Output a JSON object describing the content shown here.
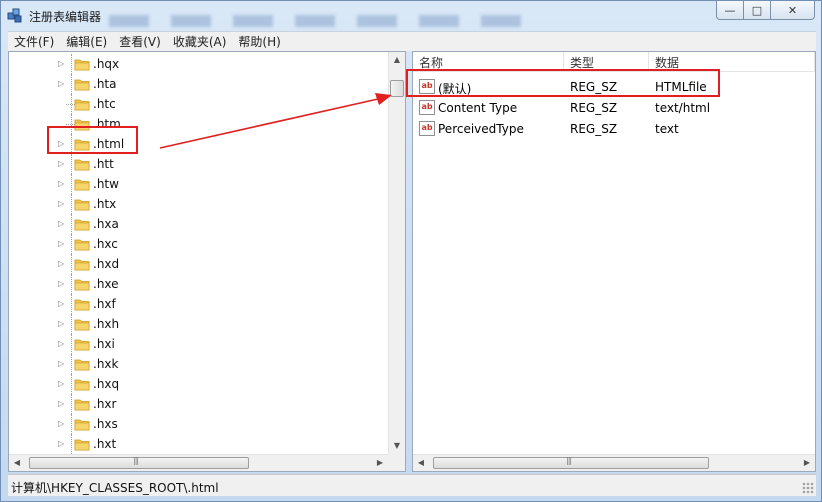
{
  "window": {
    "title": "注册表编辑器",
    "controls": {
      "minimize": "—",
      "maximize": "□",
      "close": "✕"
    }
  },
  "menu": [
    "文件(F)",
    "编辑(E)",
    "查看(V)",
    "收藏夹(A)",
    "帮助(H)"
  ],
  "tree": {
    "items": [
      ".hqx",
      ".hta",
      ".htc",
      ".htm",
      ".html",
      ".htt",
      ".htw",
      ".htx",
      ".hxa",
      ".hxc",
      ".hxd",
      ".hxe",
      ".hxf",
      ".hxh",
      ".hxi",
      ".hxk",
      ".hxq",
      ".hxr",
      ".hxs",
      ".hxt"
    ],
    "selected": ".html"
  },
  "values": {
    "columns": [
      "名称",
      "类型",
      "数据"
    ],
    "rows": [
      {
        "name": "(默认)",
        "type": "REG_SZ",
        "data": "HTMLfile",
        "icon": "ab"
      },
      {
        "name": "Content Type",
        "type": "REG_SZ",
        "data": "text/html",
        "icon": "ab"
      },
      {
        "name": "PerceivedType",
        "type": "REG_SZ",
        "data": "text",
        "icon": "ab"
      }
    ]
  },
  "status": {
    "path": "计算机\\HKEY_CLASSES_ROOT\\.html"
  },
  "scrollbar_glyphs": {
    "up": "▲",
    "down": "▼",
    "left": "◀",
    "right": "▶",
    "grip": "|||"
  },
  "colors": {
    "annotation_red": "#e02020",
    "folder_yellow": "#f2c64b"
  }
}
